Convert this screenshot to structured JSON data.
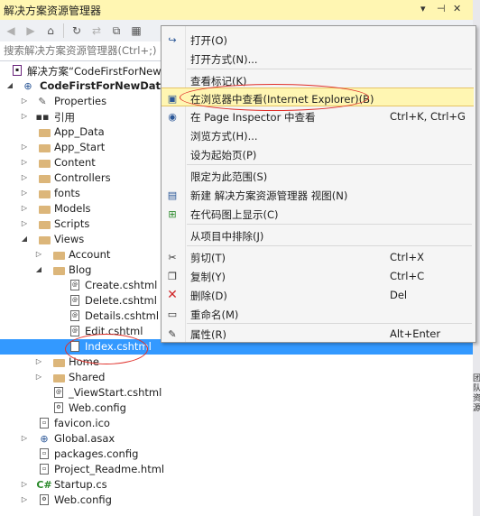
{
  "panel": {
    "title": "解决方案资源管理器",
    "ctl_dropdown": "▾",
    "ctl_pin": "⊣",
    "ctl_close": "✕"
  },
  "toolbar": {
    "back": "◀",
    "forward": "▶",
    "home": "⌂",
    "history": "↻",
    "refresh": "⇄",
    "collapse": "⧉",
    "props": "▦"
  },
  "search": {
    "placeholder": "搜索解决方案资源管理器(Ctrl+;)"
  },
  "tree": [
    {
      "label": "解决方案“CodeFirstForNewD"
    },
    {
      "label": "CodeFirstForNewDataba"
    },
    {
      "label": "Properties"
    },
    {
      "label": "引用"
    },
    {
      "label": "App_Data"
    },
    {
      "label": "App_Start"
    },
    {
      "label": "Content"
    },
    {
      "label": "Controllers"
    },
    {
      "label": "fonts"
    },
    {
      "label": "Models"
    },
    {
      "label": "Scripts"
    },
    {
      "label": "Views"
    },
    {
      "label": "Account"
    },
    {
      "label": "Blog"
    },
    {
      "label": "Create.cshtml"
    },
    {
      "label": "Delete.cshtml"
    },
    {
      "label": "Details.cshtml"
    },
    {
      "label": "Edit.cshtml"
    },
    {
      "label": "Index.cshtml"
    },
    {
      "label": "Home"
    },
    {
      "label": "Shared"
    },
    {
      "label": "_ViewStart.cshtml"
    },
    {
      "label": "Web.config"
    },
    {
      "label": "favicon.ico"
    },
    {
      "label": "Global.asax"
    },
    {
      "label": "packages.config"
    },
    {
      "label": "Project_Readme.html"
    },
    {
      "label": "Startup.cs"
    },
    {
      "label": "Web.config"
    }
  ],
  "menu": [
    {
      "label": "打开(O)",
      "shortcut": ""
    },
    {
      "label": "打开方式(N)...",
      "shortcut": ""
    },
    {
      "label": "查看标记(K)",
      "shortcut": ""
    },
    {
      "label": "在浏览器中查看(Internet Explorer)(B)",
      "shortcut": ""
    },
    {
      "label": "在 Page Inspector 中查看",
      "shortcut": "Ctrl+K, Ctrl+G"
    },
    {
      "label": "浏览方式(H)...",
      "shortcut": ""
    },
    {
      "label": "设为起始页(P)",
      "shortcut": ""
    },
    {
      "label": "限定为此范围(S)",
      "shortcut": ""
    },
    {
      "label": "新建 解决方案资源管理器 视图(N)",
      "shortcut": ""
    },
    {
      "label": "在代码图上显示(C)",
      "shortcut": ""
    },
    {
      "label": "从项目中排除(J)",
      "shortcut": ""
    },
    {
      "label": "剪切(T)",
      "shortcut": "Ctrl+X"
    },
    {
      "label": "复制(Y)",
      "shortcut": "Ctrl+C"
    },
    {
      "label": "删除(D)",
      "shortcut": "Del"
    },
    {
      "label": "重命名(M)",
      "shortcut": ""
    },
    {
      "label": "属性(R)",
      "shortcut": "Alt+Enter"
    }
  ],
  "side_tab": "团队资源"
}
